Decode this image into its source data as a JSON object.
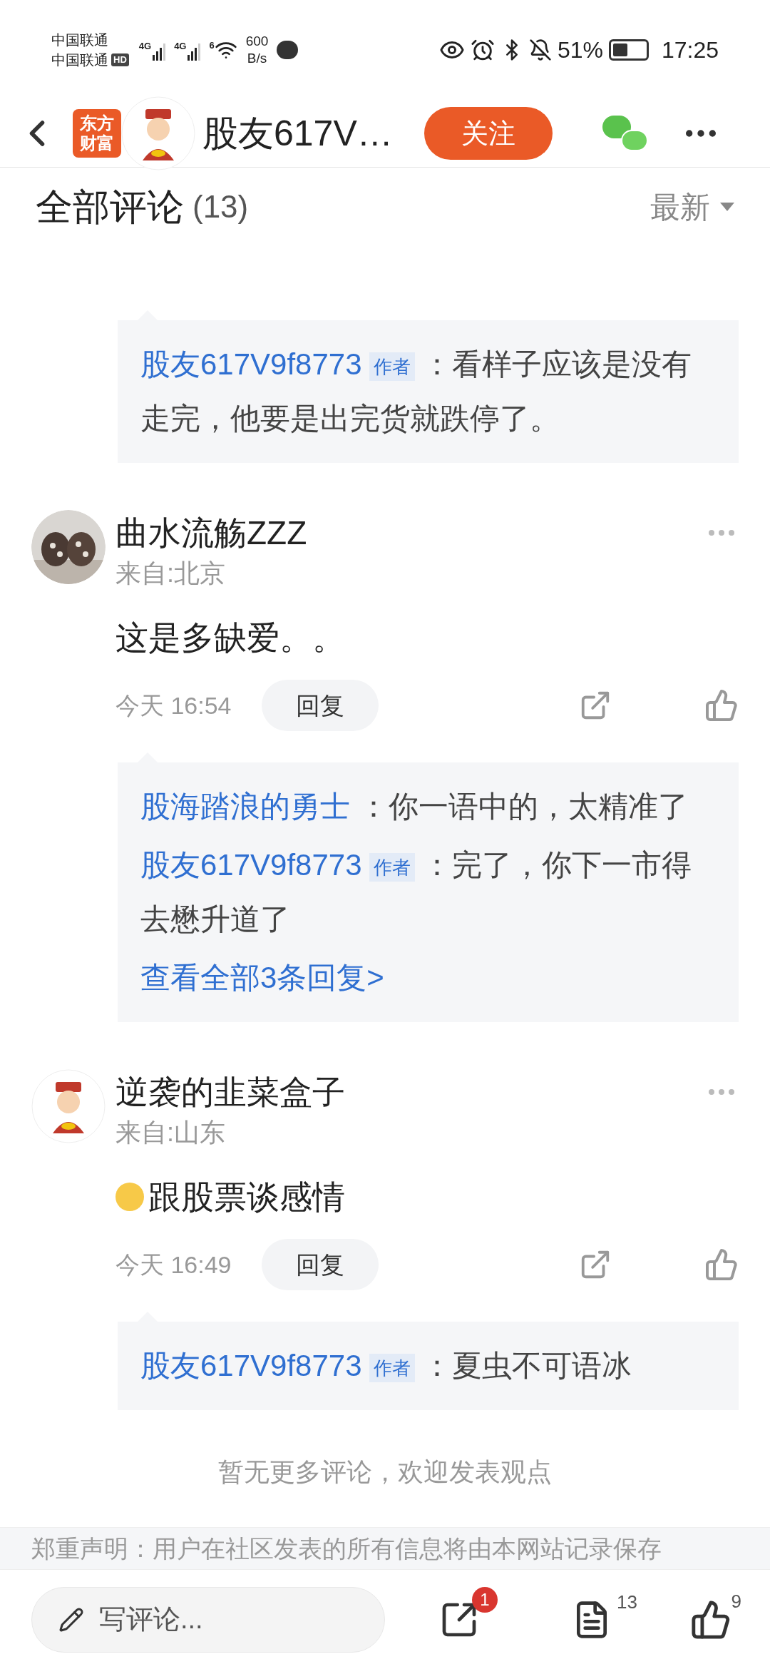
{
  "status_bar": {
    "carrier_1": "中国联通",
    "carrier_2": "中国联通",
    "hd": "HD",
    "net_1": "4G",
    "net_2": "4G",
    "wifi": "6",
    "speed_1": "600",
    "speed_2": "B/s",
    "battery": "51%",
    "time": "17:25"
  },
  "header": {
    "logo_line_1": "东方",
    "logo_line_2": "财富",
    "title": "股友617V…",
    "follow": "关注"
  },
  "section": {
    "title": "全部评论",
    "count": "(13)",
    "sort": "最新"
  },
  "top_replies": [
    {
      "user": "股友617V9f8773",
      "author_tag": "作者",
      "text": "：看样子应该是没有走完，他要是出完货就跌停了。"
    }
  ],
  "comments": [
    {
      "name": "曲水流觞ZZZ",
      "location": "来自:北京",
      "emoji": false,
      "text": "这是多缺爱。。",
      "time": "今天 16:54",
      "reply": "回复",
      "replies": [
        {
          "user": "股海踏浪的勇士",
          "text": "：你一语中的，太精准了"
        },
        {
          "user": "股友617V9f8773",
          "author_tag": "作者",
          "text": "：完了，你下一市得去懋升道了"
        }
      ],
      "more": "查看全部3条回复>"
    },
    {
      "name": "逆袭的韭菜盒子",
      "location": "来自:山东",
      "emoji": true,
      "text": "跟股票谈感情",
      "time": "今天 16:49",
      "reply": "回复",
      "replies": [
        {
          "user": "股友617V9f8773",
          "author_tag": "作者",
          "text": "：夏虫不可语冰"
        }
      ]
    }
  ],
  "end_note": "暂无更多评论，欢迎发表观点",
  "disclaimer": "郑重声明：用户在社区发表的所有信息将由本网站记录保存",
  "bottom_bar": {
    "placeholder": "写评论...",
    "share_badge": "1",
    "comment_count": "13",
    "like_count": "9"
  }
}
